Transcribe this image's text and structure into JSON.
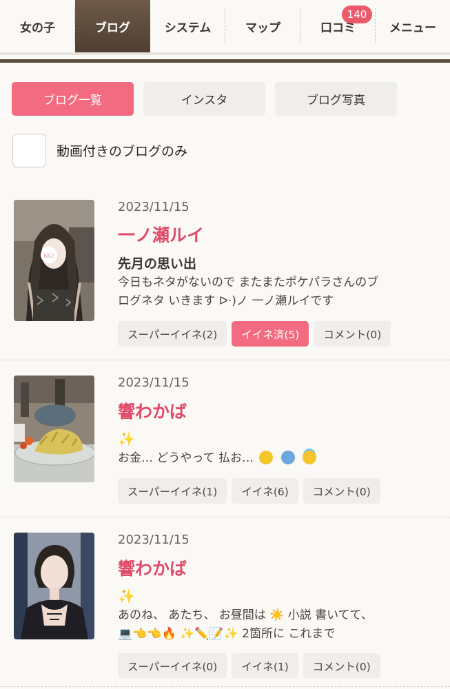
{
  "nav": {
    "items": [
      {
        "label": "女の子"
      },
      {
        "label": "ブログ"
      },
      {
        "label": "システム"
      },
      {
        "label": "マップ"
      },
      {
        "label": "口コミ"
      },
      {
        "label": "メニュー"
      }
    ],
    "review_badge": "140"
  },
  "tabs": {
    "blog_list": "ブログ一覧",
    "instagram": "インスタ",
    "blog_photos": "ブログ写真"
  },
  "filter": {
    "video_only_label": "動画付きのブログのみ"
  },
  "posts": [
    {
      "date": "2023/11/15",
      "author": "一ノ瀬ルイ",
      "title": "先月の思い出",
      "excerpt_line1": "今日もネタがないので またまたポケパラさんのブ",
      "excerpt_line2": "ログネタ いきます ᐅ·)ノ 一ノ瀬ルイです",
      "super_like": "スーパーイイネ(2)",
      "like": "イイネ済(5)",
      "comment": "コメント(0)"
    },
    {
      "date": "2023/11/15",
      "author": "響わかば",
      "sparkle": "✨",
      "excerpt_line1": "お金… どうやって 払お…",
      "super_like": "スーパーイイネ(1)",
      "like": "イイネ(6)",
      "comment": "コメント(0)"
    },
    {
      "date": "2023/11/15",
      "author": "響わかば",
      "sparkle": "✨",
      "excerpt_line1": "あのね、 あたち、 お昼間は ☀️ 小説 書いてて、",
      "excerpt_line2": "💻👈👈🔥 ✨✏️📝✨ 2箇所に これまで",
      "super_like": "スーパーイイネ(0)",
      "like": "イイネ(1)",
      "comment": "コメント(0)"
    }
  ]
}
